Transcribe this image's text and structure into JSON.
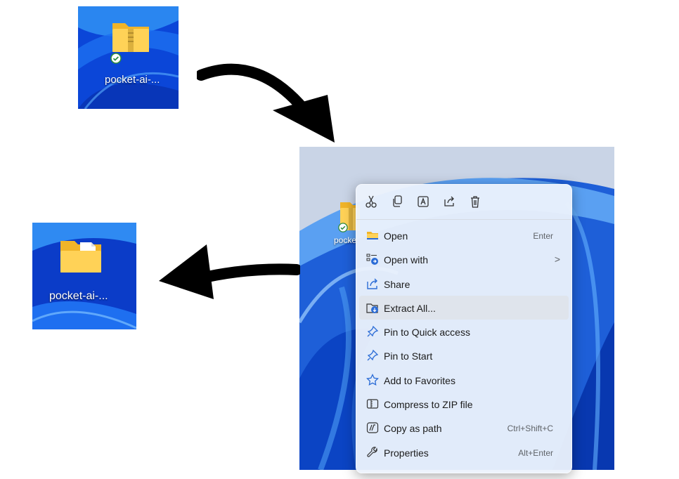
{
  "top_icon": {
    "label": "pocket-ai-..."
  },
  "left_icon": {
    "label": "pocket-ai-..."
  },
  "mid_icon": {
    "label": "pocke"
  },
  "toolbar": {
    "icons": [
      "cut-icon",
      "copy-icon",
      "rename-icon",
      "share-icon",
      "delete-icon"
    ]
  },
  "menu": {
    "items": [
      {
        "label": "Open",
        "shortcut": "Enter",
        "icon": "folder-icon"
      },
      {
        "label": "Open with",
        "shortcut": "",
        "icon": "open-with-icon",
        "submenu": ">"
      },
      {
        "label": "Share",
        "shortcut": "",
        "icon": "share-icon"
      },
      {
        "label": "Extract All...",
        "shortcut": "",
        "icon": "extract-icon",
        "highlighted": true
      },
      {
        "label": "Pin to Quick access",
        "shortcut": "",
        "icon": "pin-icon"
      },
      {
        "label": "Pin to Start",
        "shortcut": "",
        "icon": "pin-icon"
      },
      {
        "label": "Add to Favorites",
        "shortcut": "",
        "icon": "star-icon"
      },
      {
        "label": "Compress to ZIP file",
        "shortcut": "",
        "icon": "zip-icon"
      },
      {
        "label": "Copy as path",
        "shortcut": "Ctrl+Shift+C",
        "icon": "path-icon"
      },
      {
        "label": "Properties",
        "shortcut": "Alt+Enter",
        "icon": "wrench-icon"
      }
    ]
  },
  "colors": {
    "desktop_blue": "#0a3fd0",
    "menu_bg": "#ecf2fc",
    "highlight": "#dfe4ec",
    "icon_blue": "#2b6cd6"
  }
}
